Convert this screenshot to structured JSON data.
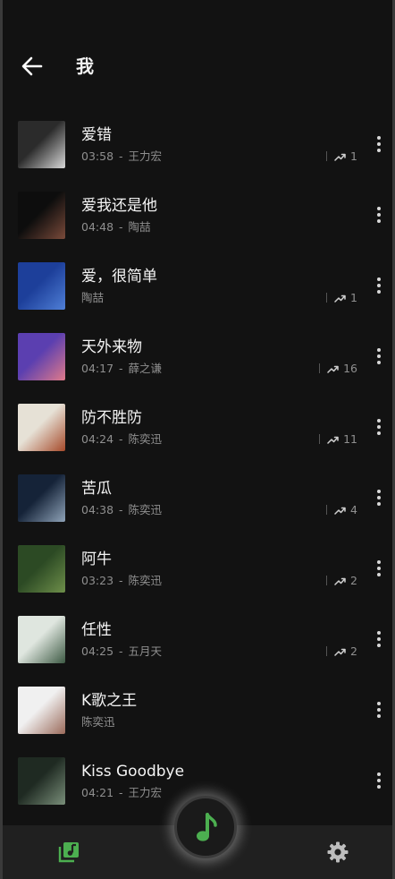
{
  "header": {
    "title": "我"
  },
  "songs": [
    {
      "title": "爱错",
      "duration": "03:58",
      "artist": "王力宏",
      "plays": "1",
      "cover": [
        "#2b2b2b",
        "#d8d8d8"
      ]
    },
    {
      "title": "爱我还是他",
      "duration": "04:48",
      "artist": "陶喆",
      "plays": "",
      "cover": [
        "#0d0d0d",
        "#7a4a3a"
      ]
    },
    {
      "title": "爱，很简单",
      "duration": "",
      "artist": "陶喆",
      "plays": "1",
      "cover": [
        "#1d3f9a",
        "#4f7fd6"
      ]
    },
    {
      "title": "天外来物",
      "duration": "04:17",
      "artist": "薛之谦",
      "plays": "16",
      "cover": [
        "#5b3fb0",
        "#e07a8a"
      ]
    },
    {
      "title": "防不胜防",
      "duration": "04:24",
      "artist": "陈奕迅",
      "plays": "11",
      "cover": [
        "#e6e1d6",
        "#a64a2a"
      ]
    },
    {
      "title": "苦瓜",
      "duration": "04:38",
      "artist": "陈奕迅",
      "plays": "4",
      "cover": [
        "#152338",
        "#8fa3b8"
      ]
    },
    {
      "title": "阿牛",
      "duration": "03:23",
      "artist": "陈奕迅",
      "plays": "2",
      "cover": [
        "#2c4a24",
        "#6e8f4a"
      ]
    },
    {
      "title": "任性",
      "duration": "04:25",
      "artist": "五月天",
      "plays": "2",
      "cover": [
        "#dfe6df",
        "#3d5a44"
      ]
    },
    {
      "title": "K歌之王",
      "duration": "",
      "artist": "陈奕迅",
      "plays": "",
      "cover": [
        "#f0f0f0",
        "#9a6a5a"
      ]
    },
    {
      "title": "Kiss Goodbye",
      "duration": "04:21",
      "artist": "王力宏",
      "plays": "",
      "cover": [
        "#1f2a22",
        "#7a8f7a"
      ]
    }
  ],
  "icons": {
    "back": "arrow-left-icon",
    "trend": "trending-up-icon",
    "more": "more-vertical-icon",
    "library": "music-library-icon",
    "player": "music-note-icon",
    "settings": "gear-icon"
  },
  "colors": {
    "accent": "#4caf50",
    "background": "#121212",
    "bottom_bar": "#202020"
  }
}
